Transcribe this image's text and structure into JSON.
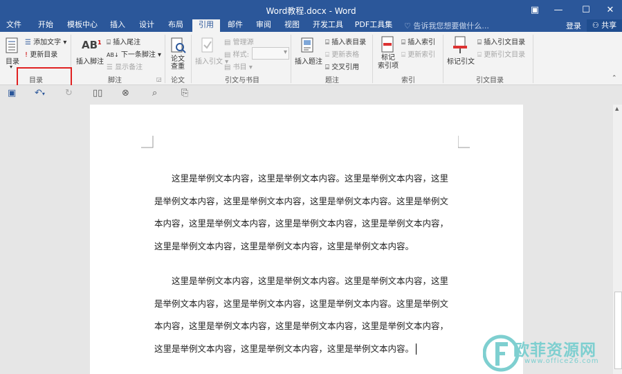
{
  "window": {
    "title": "Word教程.docx - Word"
  },
  "tabs": [
    "文件",
    "开始",
    "模板中心",
    "插入",
    "设计",
    "布局",
    "引用",
    "邮件",
    "审阅",
    "视图",
    "开发工具",
    "PDF工具集"
  ],
  "active_tab": "引用",
  "tellme": "告诉我您想要做什么...",
  "account": {
    "login": "登录",
    "share": "共享"
  },
  "ribbon": {
    "toc": {
      "main": "目录",
      "add_text": "添加文字",
      "update": "更新目录",
      "label": "目录"
    },
    "footnotes": {
      "insert_footnote": "插入脚注",
      "insert_endnote": "插入尾注",
      "next_footnote": "下一条脚注",
      "show_notes": "显示备注",
      "label": "脚注"
    },
    "research": {
      "check_line1": "论文",
      "check_line2": "查重",
      "label": "论文"
    },
    "citations": {
      "insert_citation": "插入引文",
      "manage_sources": "管理源",
      "style": "样式:",
      "bibliography": "书目",
      "label": "引文与书目"
    },
    "captions": {
      "insert_caption": "插入题注",
      "insert_table_of_figures": "插入表目录",
      "update_table": "更新表格",
      "cross_reference": "交叉引用",
      "label": "题注"
    },
    "index": {
      "mark_entry_line1": "标记",
      "mark_entry_line2": "索引项",
      "insert_index": "插入索引",
      "update_index": "更新索引",
      "label": "索引"
    },
    "toa": {
      "mark_citation": "标记引文",
      "insert_toa": "插入引文目录",
      "update_toa": "更新引文目录",
      "label": "引文目录"
    }
  },
  "document": {
    "paragraph1": [
      "这里是举例文本内容，这里是举例文本内容。这里是举例文本内容，这里",
      "是举例文本内容，这里是举例文本内容，这里是举例文本内容。这里是举例文",
      "本内容，这里是举例文本内容，这里是举例文本内容，这里是举例文本内容，",
      "这里是举例文本内容，这里是举例文本内容，这里是举例文本内容。"
    ],
    "paragraph2": [
      "这里是举例文本内容，这里是举例文本内容。这里是举例文本内容，这里",
      "是举例文本内容，这里是举例文本内容，这里是举例文本内容。这里是举例文",
      "本内容，这里是举例文本内容，这里是举例文本内容，这里是举例文本内容，",
      "这里是举例文本内容，这里是举例文本内容，这里是举例文本内容。"
    ]
  },
  "watermark": {
    "brand": "欧菲资源网",
    "url": "www.office26.com"
  },
  "colors": {
    "accent": "#2b579a",
    "highlight": "#e02020"
  }
}
